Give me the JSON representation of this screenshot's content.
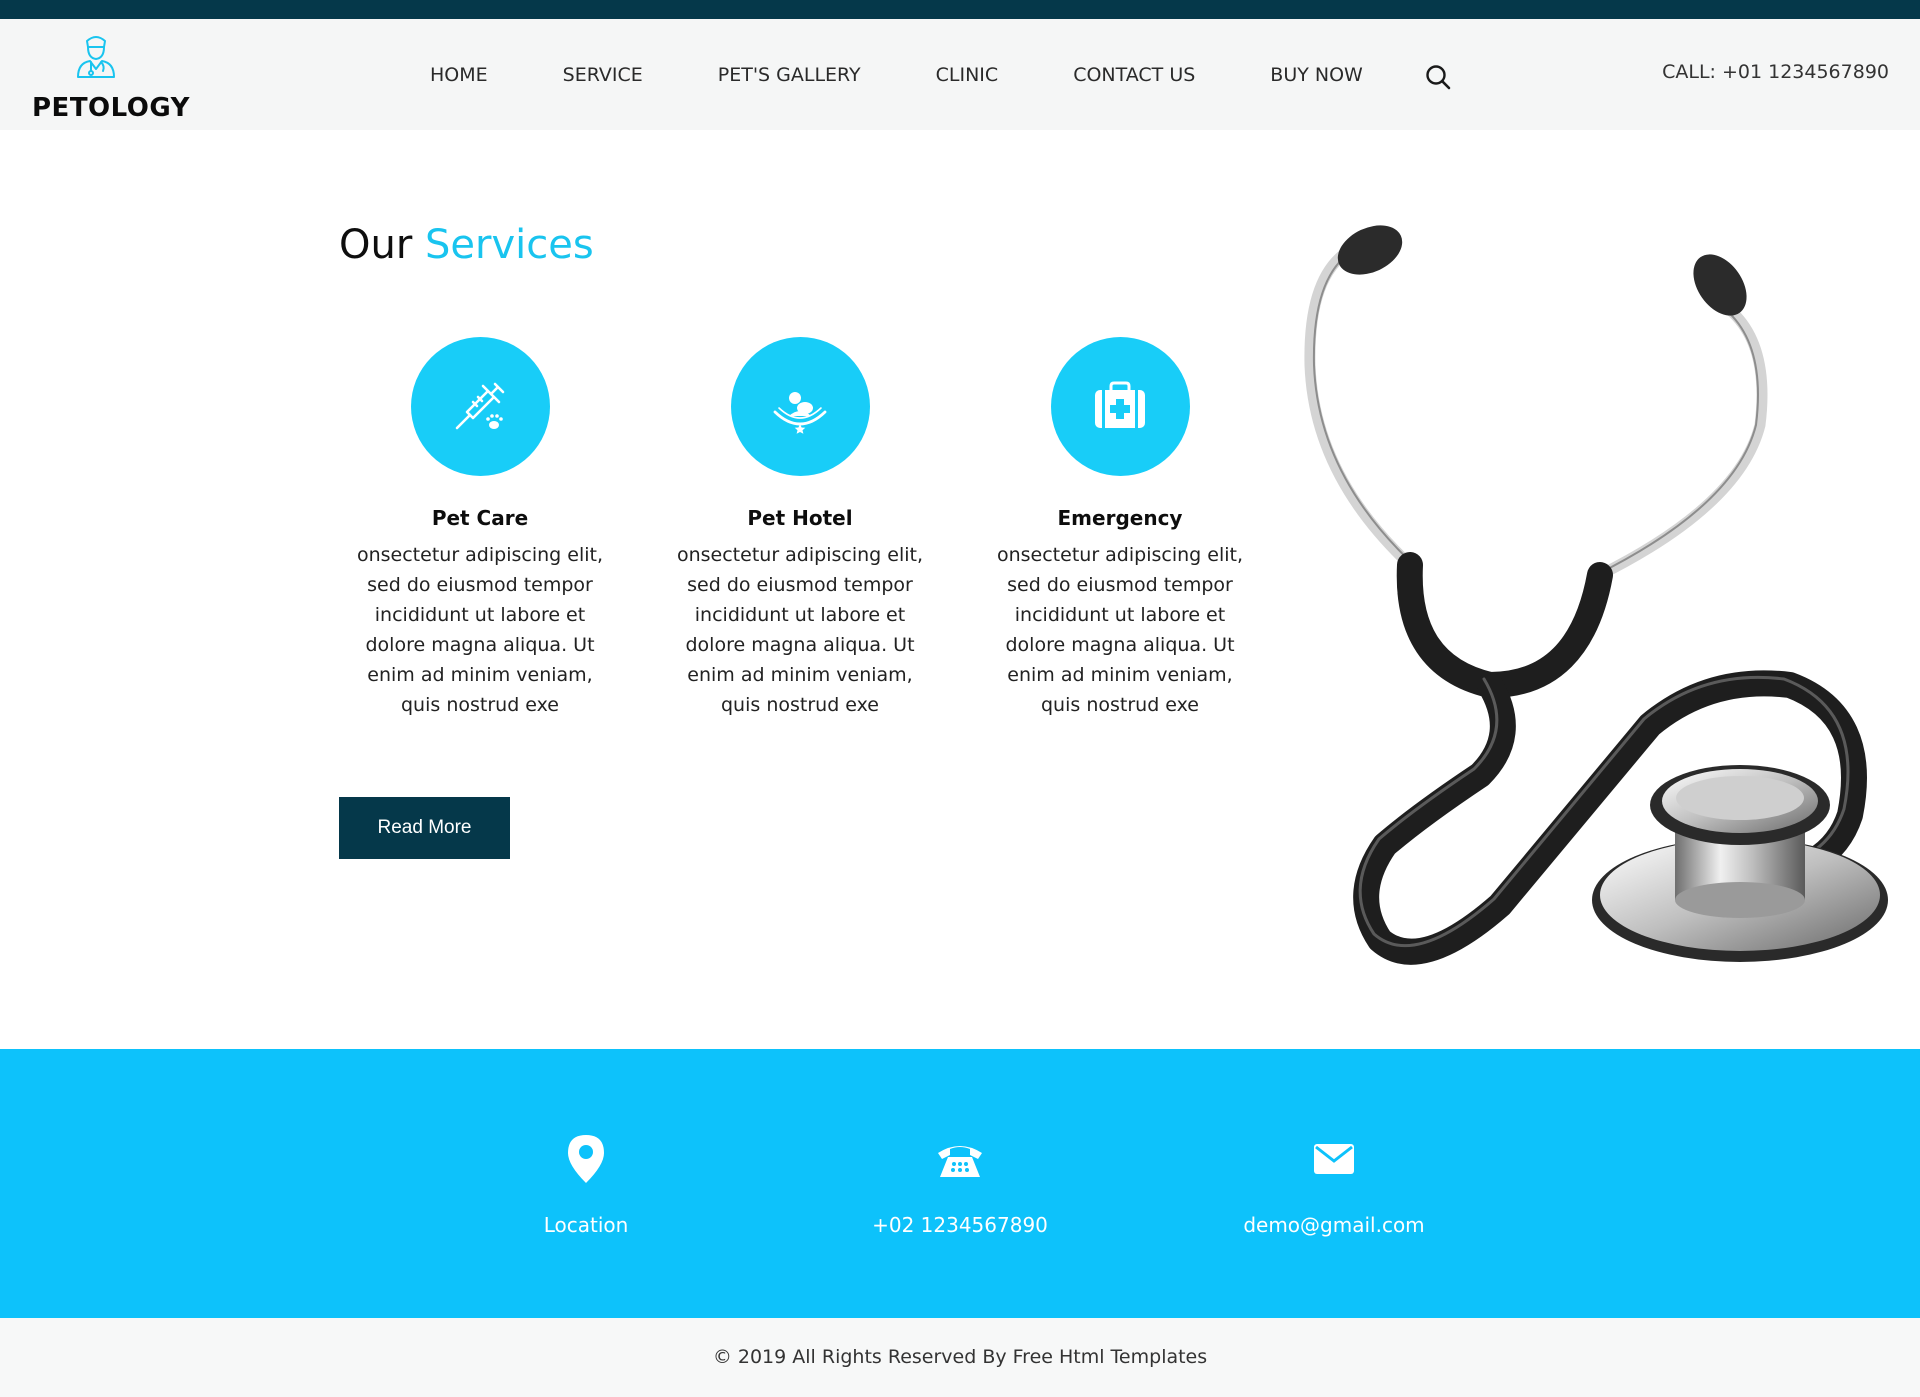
{
  "brand": {
    "name": "PETOLOGY",
    "logo_icon": "doctor-avatar-icon"
  },
  "nav": {
    "items": [
      "HOME",
      "SERVICE",
      "PET'S GALLERY",
      "CLINIC",
      "CONTACT US",
      "BUY NOW"
    ],
    "search_icon": "search-icon",
    "call": "CALL: +01 1234567890"
  },
  "services": {
    "title_plain": "Our ",
    "title_accent": "Services",
    "items": [
      {
        "icon": "syringe-paw-icon",
        "title": "Pet Care",
        "text": "onsectetur adipiscing elit, sed do eiusmod tempor incididunt ut labore et dolore magna aliqua. Ut enim ad minim veniam, quis nostrud exe"
      },
      {
        "icon": "pet-hotel-icon",
        "title": "Pet Hotel",
        "text": "onsectetur adipiscing elit, sed do eiusmod tempor incididunt ut labore et dolore magna aliqua. Ut enim ad minim veniam, quis nostrud exe"
      },
      {
        "icon": "first-aid-kit-icon",
        "title": "Emergency",
        "text": "onsectetur adipiscing elit, sed do eiusmod tempor incididunt ut labore et dolore magna aliqua. Ut enim ad minim veniam, quis nostrud exe"
      }
    ],
    "button": "Read More",
    "image": "stethoscope-image"
  },
  "contact": {
    "items": [
      {
        "icon": "location-pin-icon",
        "text": "Location"
      },
      {
        "icon": "phone-icon",
        "text": "+02 1234567890"
      },
      {
        "icon": "envelope-icon",
        "text": "demo@gmail.com"
      }
    ]
  },
  "footer": {
    "text": "© 2019 All Rights Reserved By Free Html Templates"
  },
  "colors": {
    "dark": "#05384a",
    "accent": "#18cdf8",
    "band": "#0dc2fb"
  }
}
